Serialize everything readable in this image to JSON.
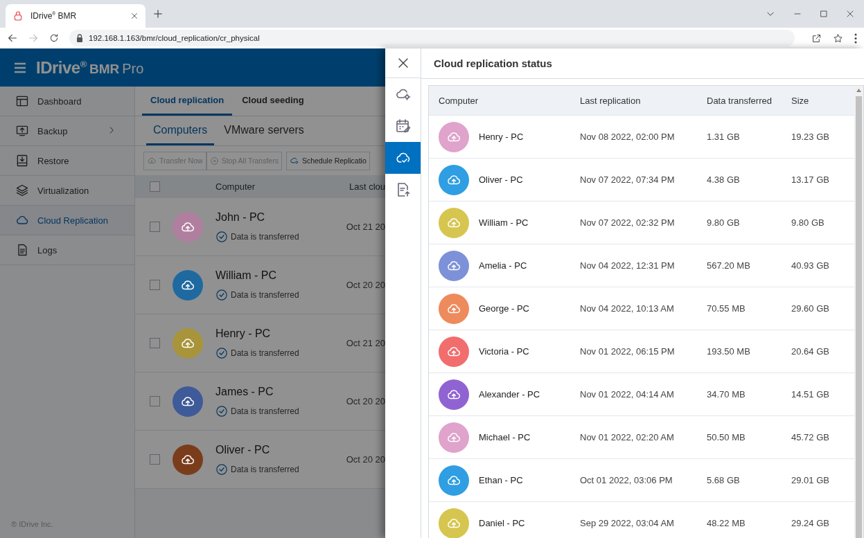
{
  "browser": {
    "tab_title": "IDrive$^{®}$ BMR",
    "url": "192.168.1.163/bmr/cloud_replication/cr_physical"
  },
  "header": {
    "logo_brand": "IDrive$^{®}$",
    "logo_product": "BMR",
    "logo_edition": "Pro"
  },
  "sidebar": {
    "items": [
      {
        "label": "Dashboard",
        "selected": false,
        "expandable": false
      },
      {
        "label": "Backup",
        "selected": false,
        "expandable": true
      },
      {
        "label": "Restore",
        "selected": false,
        "expandable": false
      },
      {
        "label": "Virtualization",
        "selected": false,
        "expandable": false
      },
      {
        "label": "Cloud Replication",
        "selected": true,
        "expandable": false
      },
      {
        "label": "Logs",
        "selected": false,
        "expandable": false
      }
    ],
    "footer": "® IDrive Inc."
  },
  "main": {
    "tabs": [
      {
        "label": "Cloud replication",
        "selected": true
      },
      {
        "label": "Cloud seeding",
        "selected": false
      }
    ],
    "subtabs": [
      {
        "label": "Computers",
        "selected": true
      },
      {
        "label": "VMware servers",
        "selected": false
      }
    ],
    "toolbar": [
      {
        "label": "Transfer Now",
        "disabled": true
      },
      {
        "label": "Stop All Transfers",
        "disabled": true
      },
      {
        "label": "Schedule Replicatio",
        "disabled": false
      }
    ],
    "table": {
      "select_all_checked": false,
      "columns": [
        "Computer",
        "Last clou"
      ],
      "rows": [
        {
          "name": "John - PC",
          "status": "Data is transferred",
          "date": "Oct 21 20",
          "color": "#b07f9f",
          "checked": false
        },
        {
          "name": "William - PC",
          "status": "Data is transferred",
          "date": "Oct 20 20",
          "color": "#1e6aa0",
          "checked": false
        },
        {
          "name": "Henry - PC",
          "status": "Data is transferred",
          "date": "Oct 21 20",
          "color": "#a8943a",
          "checked": false
        },
        {
          "name": "James - PC",
          "status": "Data is transferred",
          "date": "Oct 20 20",
          "color": "#3f5a99",
          "checked": false
        },
        {
          "name": "Oliver - PC",
          "status": "Data is transferred",
          "date": "Oct 20 20",
          "color": "#7a3d1b",
          "checked": false
        }
      ]
    }
  },
  "panel": {
    "rail": [
      {
        "selected": false
      },
      {
        "selected": false
      },
      {
        "selected": true
      },
      {
        "selected": false
      }
    ],
    "title": "Cloud replication status",
    "columns": [
      "Computer",
      "Last replication",
      "Data transferred",
      "Size"
    ],
    "rows": [
      {
        "name": "Henry - PC",
        "last": "Nov 08 2022, 02:00 PM",
        "transferred": "1.31 GB",
        "size": "19.23 GB",
        "color": "#dfa3cc"
      },
      {
        "name": "Oliver - PC",
        "last": "Nov 07 2022, 07:34 PM",
        "transferred": "4.38 GB",
        "size": "13.17 GB",
        "color": "#2f9ee2"
      },
      {
        "name": "William - PC",
        "last": "Nov 07 2022, 02:32 PM",
        "transferred": "9.80 GB",
        "size": "9.80 GB",
        "color": "#d6c650"
      },
      {
        "name": "Amelia - PC",
        "last": "Nov 04 2022, 12:31 PM",
        "transferred": "567.20 MB",
        "size": "40.93 GB",
        "color": "#7d91d8"
      },
      {
        "name": "George - PC",
        "last": "Nov 04 2022, 10:13 AM",
        "transferred": "70.55 MB",
        "size": "29.60 GB",
        "color": "#ee8b5c"
      },
      {
        "name": "Victoria - PC",
        "last": "Nov 01 2022, 06:15 PM",
        "transferred": "193.50 MB",
        "size": "20.64 GB",
        "color": "#f26d6d"
      },
      {
        "name": "Alexander - PC",
        "last": "Nov 01 2022, 04:14 AM",
        "transferred": "34.70 MB",
        "size": "14.51 GB",
        "color": "#9063d2"
      },
      {
        "name": "Michael - PC",
        "last": "Nov 01 2022, 02:20 AM",
        "transferred": "50.50 MB",
        "size": "45.72 GB",
        "color": "#dfa3cc"
      },
      {
        "name": "Ethan - PC",
        "last": "Oct 01 2022, 03:06 PM",
        "transferred": "5.68 GB",
        "size": "29.01 GB",
        "color": "#2f9ee2"
      },
      {
        "name": "Daniel - PC",
        "last": "Sep 29 2022, 03:04 AM",
        "transferred": "48.22 MB",
        "size": "29.24 GB",
        "color": "#d6c650"
      }
    ]
  }
}
